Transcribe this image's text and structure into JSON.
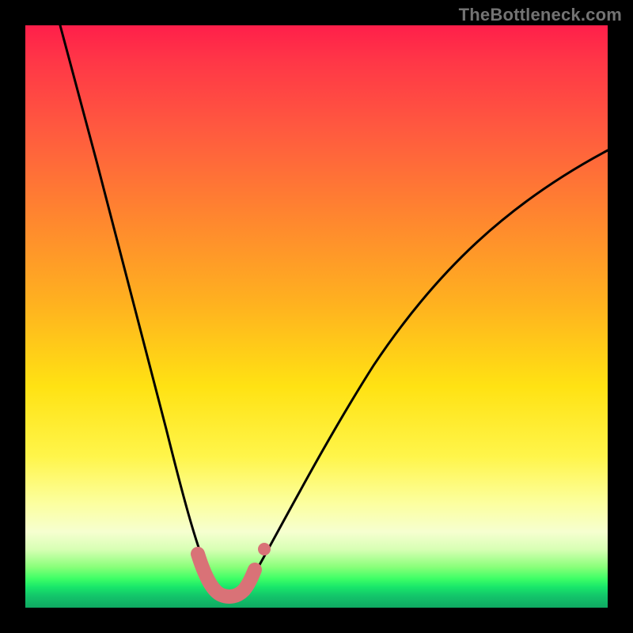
{
  "watermark": "TheBottleneck.com",
  "colors": {
    "grad_top": "#ff1f4a",
    "grad_mid1": "#ff8330",
    "grad_mid2": "#ffe213",
    "grad_low": "#fcff9e",
    "grad_bottom": "#0fa862",
    "curve": "#000000",
    "highlight": "#d97277",
    "frame": "#000000"
  },
  "chart_data": {
    "type": "line",
    "title": "",
    "xlabel": "",
    "ylabel": "",
    "xlim": [
      0,
      100
    ],
    "ylim": [
      0,
      100
    ],
    "grid": false,
    "legend": false,
    "series": [
      {
        "name": "bottleneck-curve",
        "x": [
          6,
          12,
          18,
          23,
          26,
          29,
          31,
          33,
          35,
          37,
          40,
          50,
          60,
          70,
          80,
          90,
          100
        ],
        "y": [
          100,
          78,
          52,
          30,
          17,
          8,
          4,
          2,
          2,
          4,
          9,
          26,
          42,
          55,
          65,
          73,
          79
        ]
      }
    ],
    "highlight_range_x": [
      29,
      37
    ],
    "annotations": [
      {
        "text": "TheBottleneck.com",
        "role": "watermark",
        "position": "top-right"
      }
    ]
  }
}
